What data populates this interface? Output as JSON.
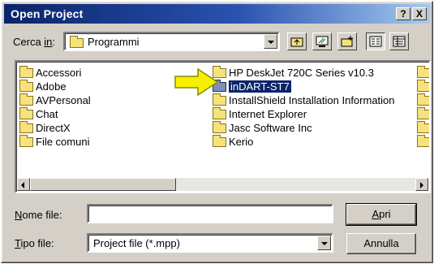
{
  "window": {
    "title": "Open Project",
    "help_label": "?",
    "close_label": "X"
  },
  "look_in": {
    "label_prefix": "Cerca ",
    "label_mnemonic": "in",
    "label_suffix": ":",
    "value": "Programmi"
  },
  "toolbar": {
    "buttons": [
      "up-one-level",
      "desktop",
      "create-new-folder",
      "list-view",
      "details-view"
    ]
  },
  "files": [
    {
      "name": "Accessori"
    },
    {
      "name": "Adobe"
    },
    {
      "name": "AVPersonal"
    },
    {
      "name": "Chat"
    },
    {
      "name": "DirectX"
    },
    {
      "name": "File comuni"
    },
    {
      "name": "HP DeskJet 720C Series v10.3"
    },
    {
      "name": "inDART-ST7",
      "selected": true
    },
    {
      "name": "InstallShield Installation Information"
    },
    {
      "name": "Internet Explorer"
    },
    {
      "name": "Jasc Software Inc"
    },
    {
      "name": "Kerio"
    }
  ],
  "file_name": {
    "label_mnemonic": "N",
    "label_rest": "ome file:",
    "value": ""
  },
  "file_type": {
    "label_mnemonic": "T",
    "label_rest": "ipo file:",
    "value": "Project file (*.mpp)"
  },
  "buttons": {
    "open_mnemonic": "A",
    "open_rest": "pri",
    "cancel": "Annulla"
  },
  "colors": {
    "titlebar": "#0a246a",
    "selection": "#0a246a",
    "annotation_arrow": "#f5f000"
  },
  "icons": {
    "annotation": "right-arrow-icon"
  }
}
